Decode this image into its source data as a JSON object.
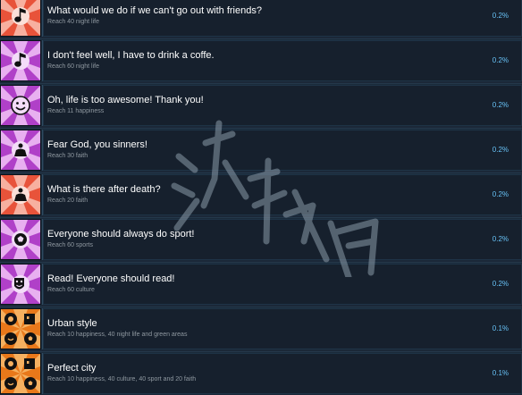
{
  "colors": {
    "background": "#1b2838",
    "title": "#ffffff",
    "description": "#8f98a0",
    "percent": "#67c1f5"
  },
  "achievements": [
    {
      "title": "What would we do if we can't go out with friends?",
      "description": "Reach 40 night life",
      "percent": "0.2%",
      "icon": "music-note-icon",
      "color": "#e8533a"
    },
    {
      "title": "I don't feel well, I have to drink a coffe.",
      "description": "Reach 60 night life",
      "percent": "0.2%",
      "icon": "music-note-icon",
      "color": "#b040c8"
    },
    {
      "title": "Oh, life is too awesome! Thank you!",
      "description": "Reach 11 happiness",
      "percent": "0.2%",
      "icon": "smiley-icon",
      "color": "#b040c8"
    },
    {
      "title": "Fear God, you sinners!",
      "description": "Reach 30 faith",
      "percent": "0.2%",
      "icon": "praying-person-icon",
      "color": "#b040c8"
    },
    {
      "title": "What is there after death?",
      "description": "Reach 20 faith",
      "percent": "0.2%",
      "icon": "praying-person-icon",
      "color": "#e8533a"
    },
    {
      "title": "Everyone should always do sport!",
      "description": "Reach 60 sports",
      "percent": "0.2%",
      "icon": "soccer-ball-icon",
      "color": "#b040c8"
    },
    {
      "title": "Read! Everyone should read!",
      "description": "Reach 60 culture",
      "percent": "0.2%",
      "icon": "theater-masks-icon",
      "color": "#b040c8"
    },
    {
      "title": "Urban style",
      "description": "Reach 10 happiness, 40 night life and green areas",
      "percent": "0.1%",
      "icon": "city-mixed-icon",
      "color": "#e8781a"
    },
    {
      "title": "Perfect city",
      "description": "Reach 10 happiness, 40 culture, 40 sport and 20 faith",
      "percent": "0.1%",
      "icon": "city-mixed-icon",
      "color": "#e8781a"
    }
  ]
}
